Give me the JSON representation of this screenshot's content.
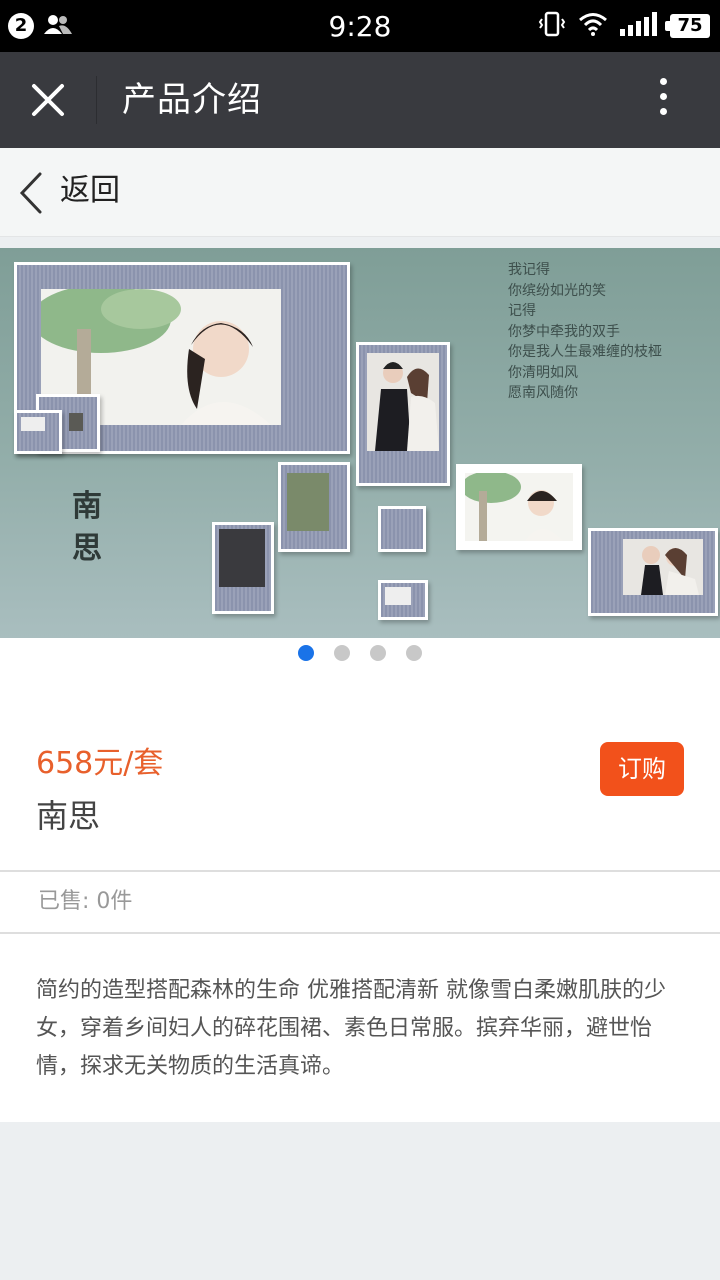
{
  "status_bar": {
    "notification_count": "2",
    "time": "9:28",
    "battery": "75"
  },
  "title_bar": {
    "title": "产品介绍"
  },
  "back_bar": {
    "label": "返回"
  },
  "banner": {
    "title": "南思",
    "poem": [
      "我记得",
      "你缤纷如光的笑",
      "记得",
      "你梦中牵我的双手",
      "你是我人生最难缠的枝桠",
      "你清明如风",
      "愿南风随你"
    ],
    "slide_count": 4,
    "active_slide": 1
  },
  "product": {
    "price": "658元/套",
    "name": "南思",
    "buy_label": "订购",
    "sold": "已售: 0件",
    "description": "简约的造型搭配森林的生命 优雅搭配清新 就像雪白柔嫩肌肤的少女，穿着乡间妇人的碎花围裙、素色日常服。摈弃华丽，避世怡情，探求无关物质的生活真谛。"
  },
  "colors": {
    "title_bar": "#393a3f",
    "accent_orange": "#f2511b",
    "price": "#e8602c",
    "dot_active": "#1a73e8"
  },
  "icons": [
    "close-icon",
    "more-vertical-icon",
    "back-arrow-icon",
    "contacts-icon",
    "vibrate-icon",
    "wifi-icon",
    "signal-icon",
    "battery-icon"
  ]
}
